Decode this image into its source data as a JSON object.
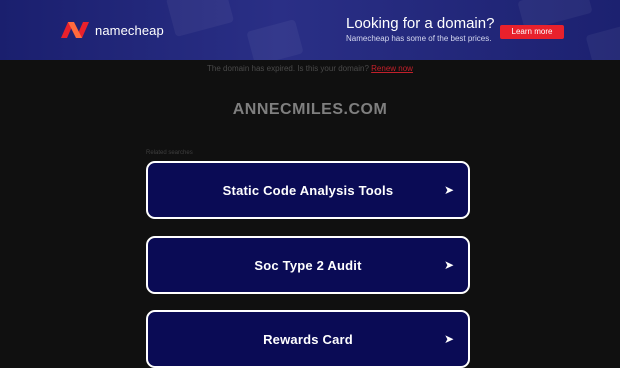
{
  "banner": {
    "brand": "namecheap",
    "promo_title": "Looking for a domain?",
    "promo_subtitle": "Namecheap has some of the best prices.",
    "learn_more_label": "Learn more"
  },
  "notice": {
    "text": "The domain has expired. Is this your domain?",
    "renew_label": "Renew now"
  },
  "domain_name": "ANNECMILES.COM",
  "related_label": "Related searches",
  "searches": [
    {
      "label": "Static Code Analysis Tools",
      "arrow": "➤"
    },
    {
      "label": "Soc Type 2 Audit",
      "arrow": "➤"
    },
    {
      "label": "Rewards Card",
      "arrow": "➤"
    }
  ],
  "colors": {
    "banner": "#252a7e",
    "brand_red": "#e8212c",
    "card_bg": "#0a0b55",
    "page_bg": "#101010"
  }
}
